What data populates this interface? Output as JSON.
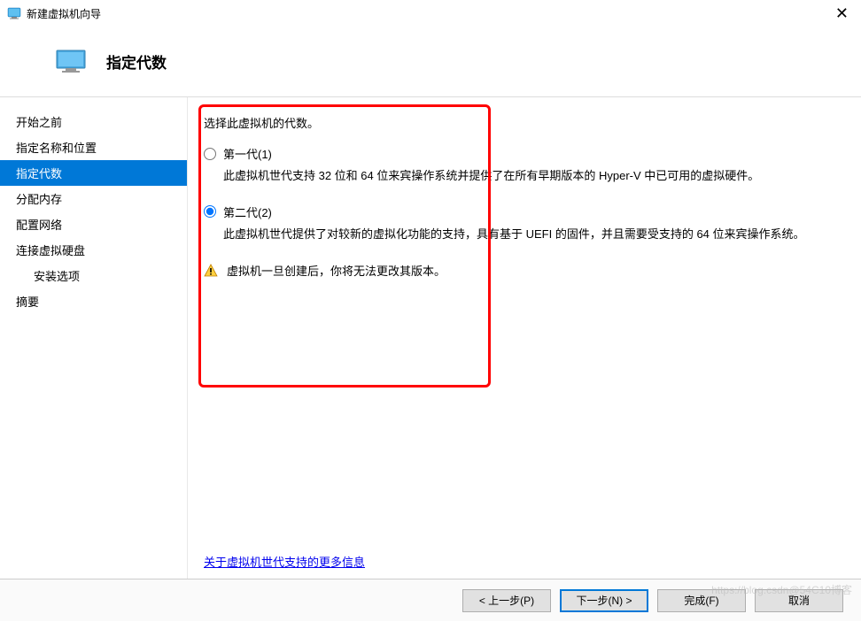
{
  "window": {
    "title": "新建虚拟机向导"
  },
  "header": {
    "title": "指定代数"
  },
  "sidebar": {
    "items": [
      {
        "label": "开始之前",
        "active": false,
        "indent": false
      },
      {
        "label": "指定名称和位置",
        "active": false,
        "indent": false
      },
      {
        "label": "指定代数",
        "active": true,
        "indent": false
      },
      {
        "label": "分配内存",
        "active": false,
        "indent": false
      },
      {
        "label": "配置网络",
        "active": false,
        "indent": false
      },
      {
        "label": "连接虚拟硬盘",
        "active": false,
        "indent": false
      },
      {
        "label": "安装选项",
        "active": false,
        "indent": true
      },
      {
        "label": "摘要",
        "active": false,
        "indent": false
      }
    ]
  },
  "main": {
    "prompt": "选择此虚拟机的代数。",
    "option1": {
      "label": "第一代(1)",
      "desc": "此虚拟机世代支持 32 位和 64 位来宾操作系统并提供了在所有早期版本的 Hyper-V 中已可用的虚拟硬件。"
    },
    "option2": {
      "label": "第二代(2)",
      "desc": "此虚拟机世代提供了对较新的虚拟化功能的支持，具有基于 UEFI 的固件，并且需要受支持的 64 位来宾操作系统。"
    },
    "warning": "虚拟机一旦创建后，你将无法更改其版本。",
    "link": "关于虚拟机世代支持的更多信息"
  },
  "footer": {
    "prev": "< 上一步(P)",
    "next": "下一步(N) >",
    "finish": "完成(F)",
    "cancel": "取消"
  },
  "watermark": "https://blog.csdn@54C10博客"
}
